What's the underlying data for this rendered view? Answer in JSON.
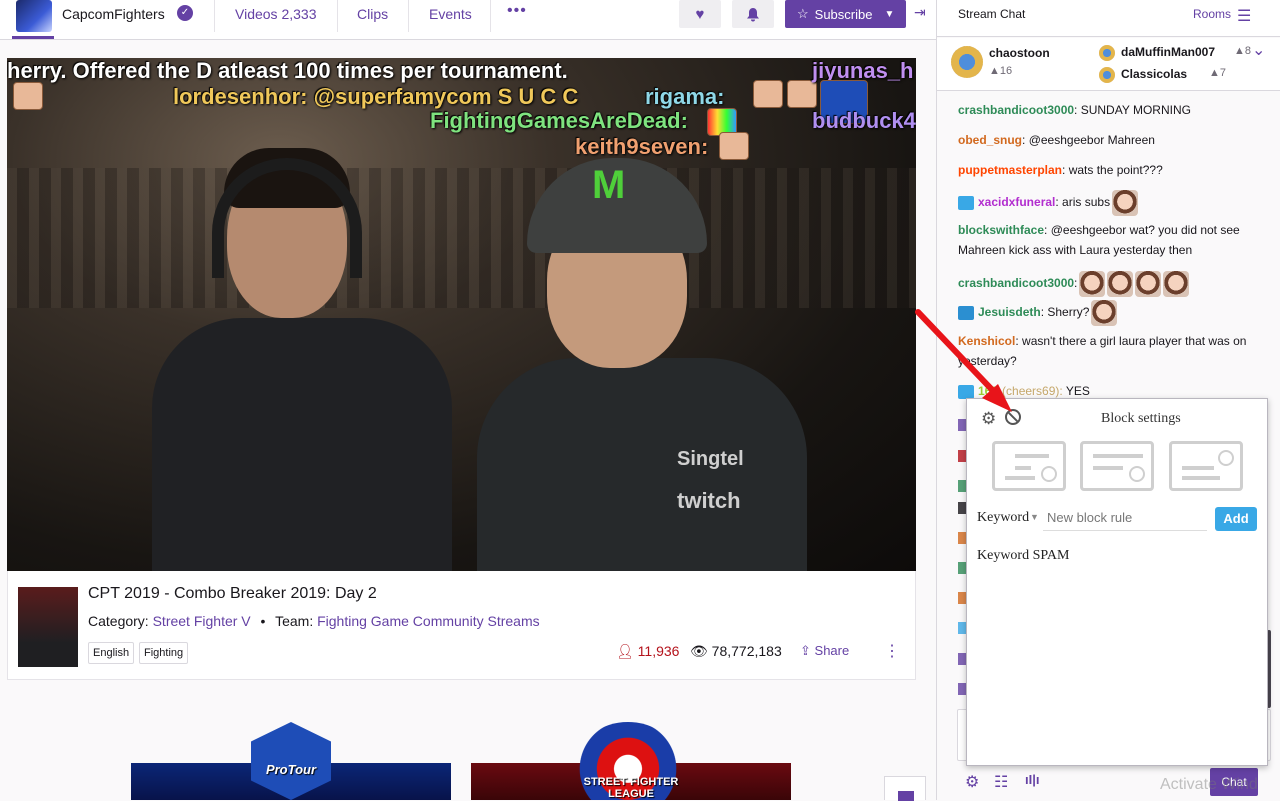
{
  "topnav": {
    "channel_name": "CapcomFighters",
    "verified_icon": "check-circle-icon",
    "tabs": [
      {
        "label": "Videos",
        "count": "2,333"
      },
      {
        "label": "Clips"
      },
      {
        "label": "Events"
      }
    ],
    "more_label": "•••",
    "follow_icon": "heart-icon",
    "notify_icon": "bell-icon",
    "subscribe_label": "Subscribe",
    "collapse_label": "⇥"
  },
  "video": {
    "overlays": [
      "herry. Offered the D atleast 100 times per tournament.",
      "lordesenhor: @superfamycom S U C C",
      "rigama:",
      "FightingGamesAreDead:",
      "keith9seven:",
      "jiyunas_h",
      "budbuck4"
    ],
    "shirt_text": "Singtel",
    "shirt_text2": "twitch"
  },
  "stream_info": {
    "title": "CPT 2019 - Combo Breaker 2019: Day 2",
    "category_label": "Category:",
    "category": "Street Fighter V",
    "team_label": "Team:",
    "team": "Fighting Game Community Streams",
    "tags": [
      "English",
      "Fighting"
    ],
    "viewers": "11,936",
    "views": "78,772,183",
    "share_label": "Share"
  },
  "banners": {
    "cpt_text": "ProTour",
    "sfl_text": "STREET FIGHTER LEAGUE"
  },
  "chat": {
    "title": "Stream Chat",
    "rooms_label": "Rooms",
    "leaderboard": [
      {
        "name": "chaostoon",
        "score": "16"
      },
      {
        "name": "daMuffinMan007",
        "score": "8"
      },
      {
        "name": "Classicolas",
        "score": "7"
      }
    ],
    "messages": [
      {
        "user": "crashbandicoot3000",
        "color": "#2e8b57",
        "text": " SUNDAY MORNING"
      },
      {
        "user": "obed_snug",
        "color": "#d2691e",
        "text": " @eeshgeebor Mahreen"
      },
      {
        "user": "puppetmasterplan",
        "color": "#ff4500",
        "text": " wats the point???"
      },
      {
        "user": "xacidxfuneral",
        "color": "#b22dcf",
        "text": " aris subs"
      },
      {
        "user": "blockswithface",
        "color": "#2e8b57",
        "text": " @eeshgeebor wat? you did not see Mahreen kick ass with Laura yesterday then"
      },
      {
        "user": "crashbandicoot3000",
        "color": "#2e8b57",
        "text": ""
      },
      {
        "user": "Jesuisdeth",
        "color": "#2e8b57",
        "text": " Sherry?"
      },
      {
        "user": "Kenshicol",
        "color": "#d2691e",
        "text": " wasn't there a girl laura player that was on yesterday?"
      },
      {
        "user": "169",
        "color": "#9acd32",
        "cheer": "(cheers69):",
        "text": " YES"
      }
    ],
    "send_label": "Chat",
    "settings_icon": "gear-icon",
    "list_icon": "list-icon",
    "stats_icon": "bar-chart-icon"
  },
  "block_settings": {
    "title": "Block settings",
    "type_label": "Keyword",
    "input_placeholder": "New block rule",
    "add_label": "Add",
    "rules": [
      "Keyword SPAM"
    ]
  },
  "watermark": "Activate Wind",
  "colors": {
    "accent": "#6441a4",
    "add_button": "#39a8e6",
    "viewers": "#b4121b",
    "arrow": "#e8141a"
  }
}
